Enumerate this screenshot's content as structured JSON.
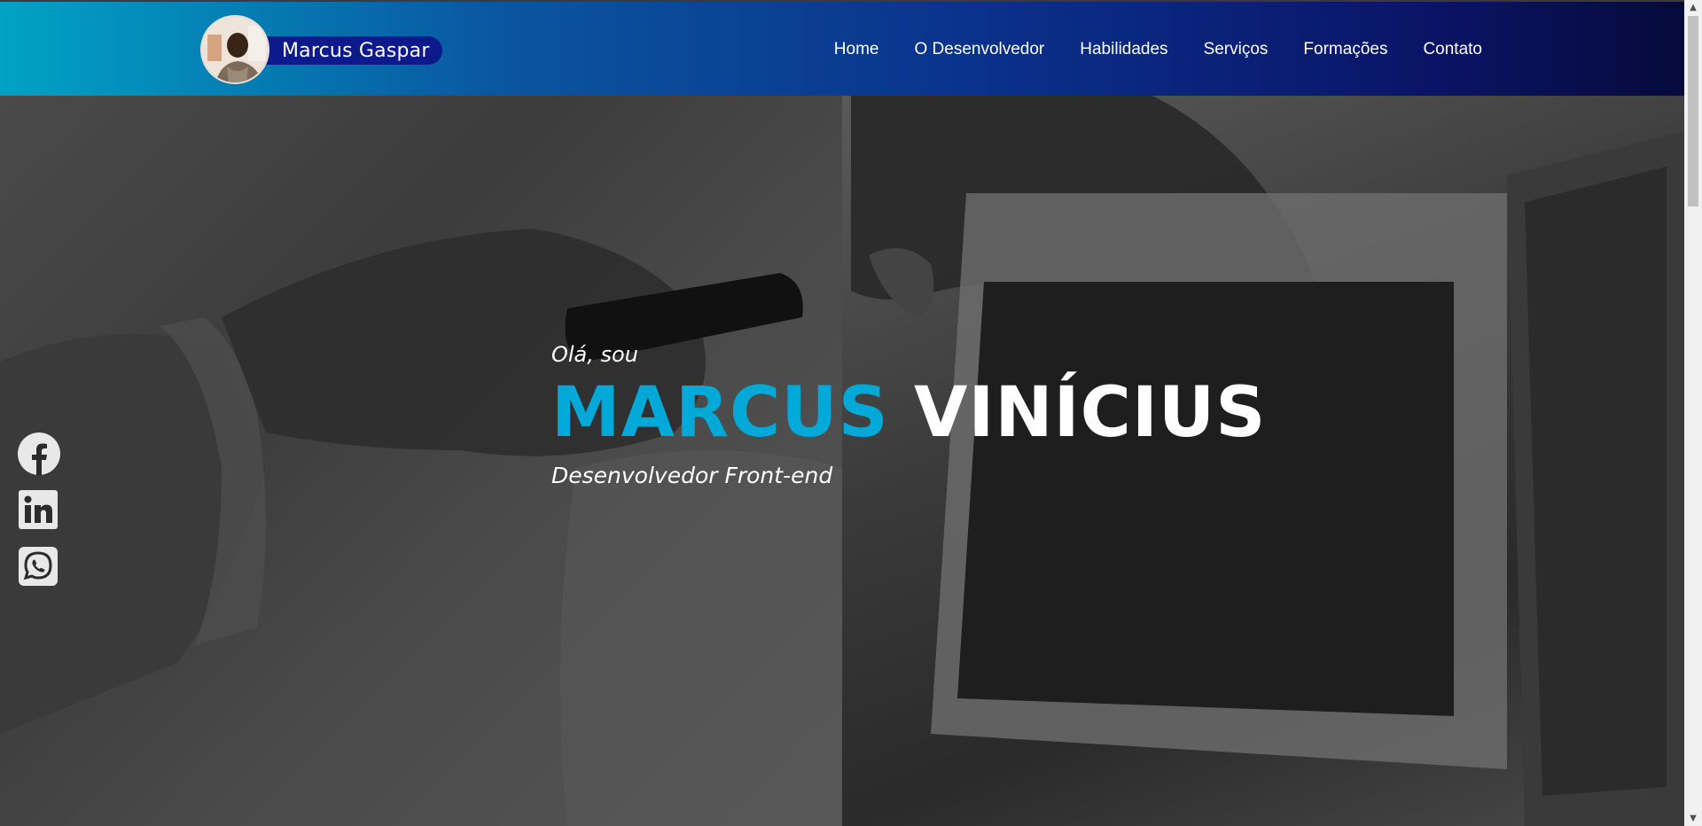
{
  "header": {
    "brand_name": "Marcus Gaspar",
    "nav": [
      {
        "label": "Home"
      },
      {
        "label": "O Desenvolvedor"
      },
      {
        "label": "Habilidades"
      },
      {
        "label": "Serviços"
      },
      {
        "label": "Formações"
      },
      {
        "label": "Contato"
      }
    ]
  },
  "hero": {
    "greeting": "Olá, sou",
    "first_name": "MARCUS",
    "last_name": "VINÍCIUS",
    "subtitle": "Desenvolvedor Front-end"
  },
  "social": [
    {
      "icon": "facebook-icon"
    },
    {
      "icon": "linkedin-icon"
    },
    {
      "icon": "whatsapp-icon"
    }
  ],
  "colors": {
    "accent": "#00a9d8",
    "header_start": "#00a3c4",
    "header_end": "#060a3a",
    "brand_pill": "#0c1a8c"
  }
}
